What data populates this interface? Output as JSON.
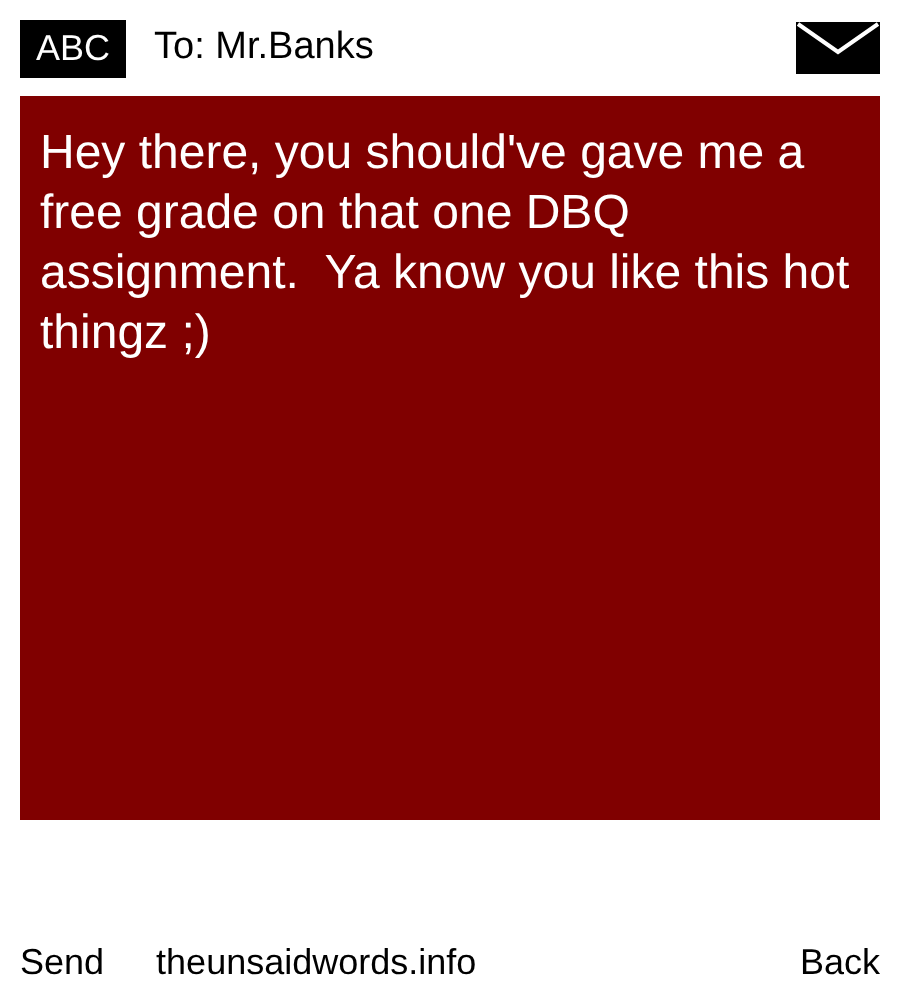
{
  "header": {
    "mode": "ABC",
    "recipient": "To: Mr.Banks"
  },
  "message": {
    "text": "Hey there, you should've gave me a free grade on that one DBQ assignment.  Ya know you like this hot thingz ;)"
  },
  "footer": {
    "left": "Send",
    "center": "theunsaidwords.info",
    "right": "Back"
  }
}
